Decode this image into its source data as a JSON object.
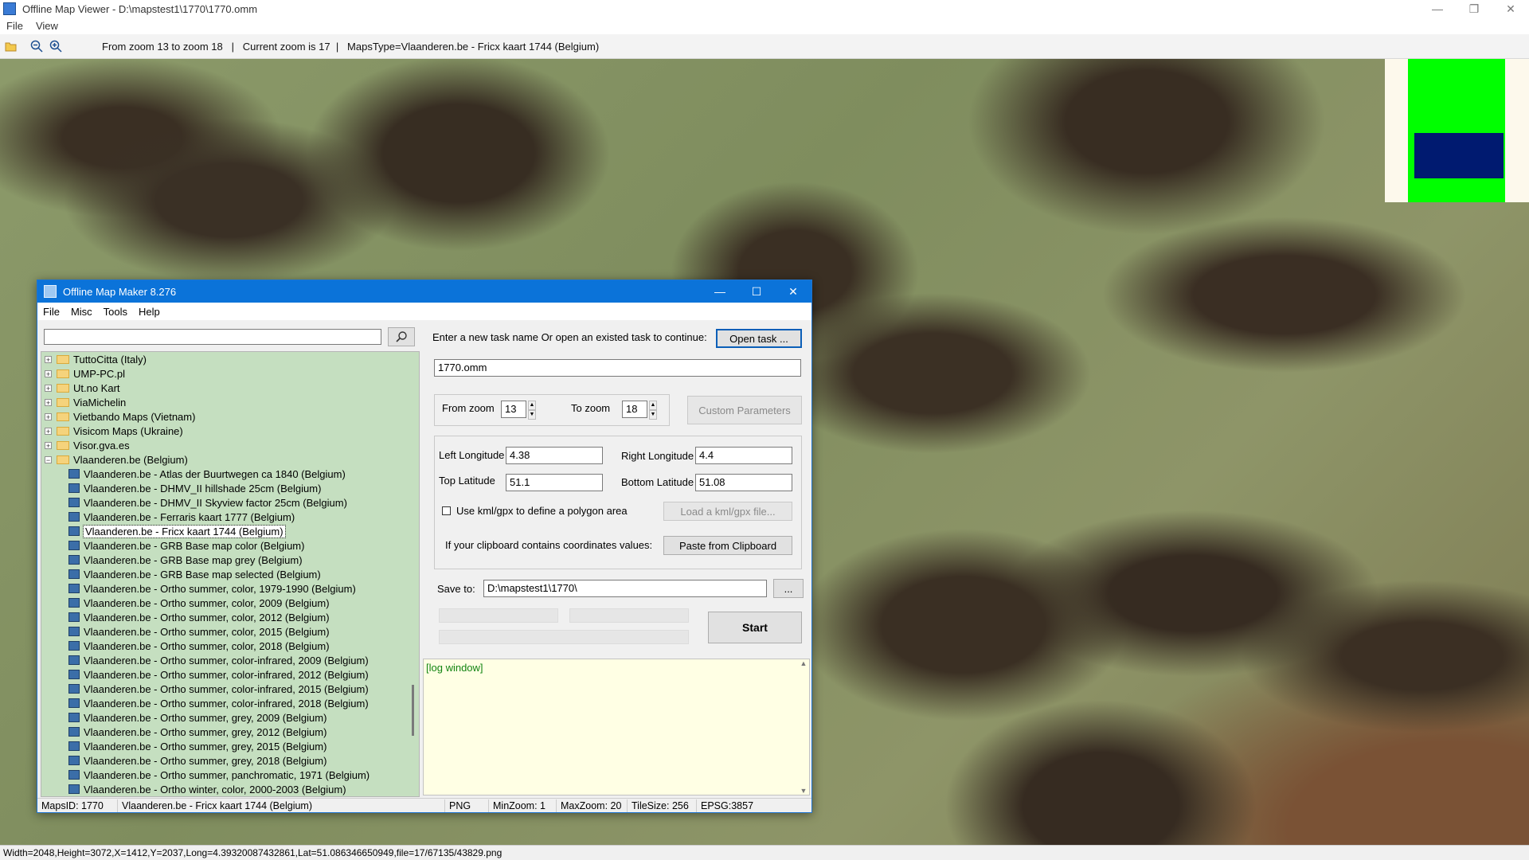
{
  "viewer": {
    "title": "Offline Map Viewer - D:\\mapstest1\\1770\\1770.omm",
    "menu": [
      "File",
      "View"
    ],
    "toolbar_info": "From zoom 13 to zoom 18   |   Current zoom is 17  |   MapsType=Vlaanderen.be - Fricx kaart 1744 (Belgium)",
    "status": "Width=2048,Height=3072,X=1412,Y=2037,Long=4.39320087432861,Lat=51.086346650949,file=17/67135/43829.png",
    "icons": [
      "folder-open-icon",
      "zoom-out-icon",
      "zoom-in-icon"
    ]
  },
  "dialog": {
    "title": "Offline Map Maker 8.276",
    "menu": [
      "File",
      "Misc",
      "Tools",
      "Help"
    ],
    "search_value": "",
    "tree": {
      "folders_before": [
        "TuttoCitta (Italy)",
        "UMP-PC.pl",
        "Ut.no Kart",
        "ViaMichelin",
        "Vietbando Maps (Vietnam)",
        "Visicom Maps (Ukraine)",
        "Visor.gva.es"
      ],
      "open_folder": "Vlaanderen.be (Belgium)",
      "children": [
        "Vlaanderen.be - Atlas der Buurtwegen ca 1840 (Belgium)",
        "Vlaanderen.be - DHMV_II hillshade 25cm (Belgium)",
        "Vlaanderen.be - DHMV_II Skyview factor 25cm (Belgium)",
        "Vlaanderen.be - Ferraris kaart 1777 (Belgium)",
        "Vlaanderen.be - Fricx kaart 1744 (Belgium)",
        "Vlaanderen.be - GRB Base map color (Belgium)",
        "Vlaanderen.be - GRB Base map grey (Belgium)",
        "Vlaanderen.be - GRB Base map selected (Belgium)",
        "Vlaanderen.be - Ortho summer, color, 1979-1990 (Belgium)",
        "Vlaanderen.be - Ortho summer, color, 2009 (Belgium)",
        "Vlaanderen.be - Ortho summer, color, 2012 (Belgium)",
        "Vlaanderen.be - Ortho summer, color, 2015 (Belgium)",
        "Vlaanderen.be - Ortho summer, color, 2018 (Belgium)",
        "Vlaanderen.be - Ortho summer, color-infrared, 2009 (Belgium)",
        "Vlaanderen.be - Ortho summer, color-infrared, 2012 (Belgium)",
        "Vlaanderen.be - Ortho summer, color-infrared, 2015 (Belgium)",
        "Vlaanderen.be - Ortho summer, color-infrared, 2018 (Belgium)",
        "Vlaanderen.be - Ortho summer, grey, 2009 (Belgium)",
        "Vlaanderen.be - Ortho summer, grey, 2012 (Belgium)",
        "Vlaanderen.be - Ortho summer, grey, 2015 (Belgium)",
        "Vlaanderen.be - Ortho summer, grey, 2018 (Belgium)",
        "Vlaanderen.be - Ortho summer, panchromatic, 1971 (Belgium)",
        "Vlaanderen.be - Ortho winter, color, 2000-2003 (Belgium)"
      ],
      "selected_index": 4
    },
    "task_prompt": "Enter a new task name Or open an existed task to continue:",
    "open_task_label": "Open task ...",
    "task_name": "1770.omm",
    "from_zoom_label": "From zoom",
    "from_zoom": "13",
    "to_zoom_label": "To zoom",
    "to_zoom": "18",
    "custom_params_label": "Custom Parameters",
    "left_lon_label": "Left Longitude",
    "left_lon": "4.38",
    "right_lon_label": "Right Longitude",
    "right_lon": "4.4",
    "top_lat_label": "Top Latitude",
    "top_lat": "51.1",
    "bottom_lat_label": "Bottom Latitude",
    "bottom_lat": "51.08",
    "kml_checkbox_label": "Use kml/gpx to define a polygon area",
    "load_kml_label": "Load a kml/gpx file...",
    "clipboard_prompt": "If your clipboard contains coordinates values:",
    "paste_label": "Paste from Clipboard",
    "save_to_label": "Save to:",
    "save_to": "D:\\mapstest1\\1770\\",
    "browse_label": "...",
    "start_label": "Start",
    "log_text": "[log window]",
    "status": {
      "maps_id": "MapsID: 1770",
      "map_name": "Vlaanderen.be - Fricx kaart 1744 (Belgium)",
      "format": "PNG",
      "min_zoom": "MinZoom: 1",
      "max_zoom": "MaxZoom: 20",
      "tile_size": "TileSize: 256",
      "epsg": "EPSG:3857"
    }
  },
  "colors": {
    "dialog_title_bg": "#0b73d9",
    "tree_bg": "#c5dfc0",
    "log_bg": "#ffffe4",
    "minimap_green": "#00ff00",
    "minimap_blue": "#001a70"
  }
}
